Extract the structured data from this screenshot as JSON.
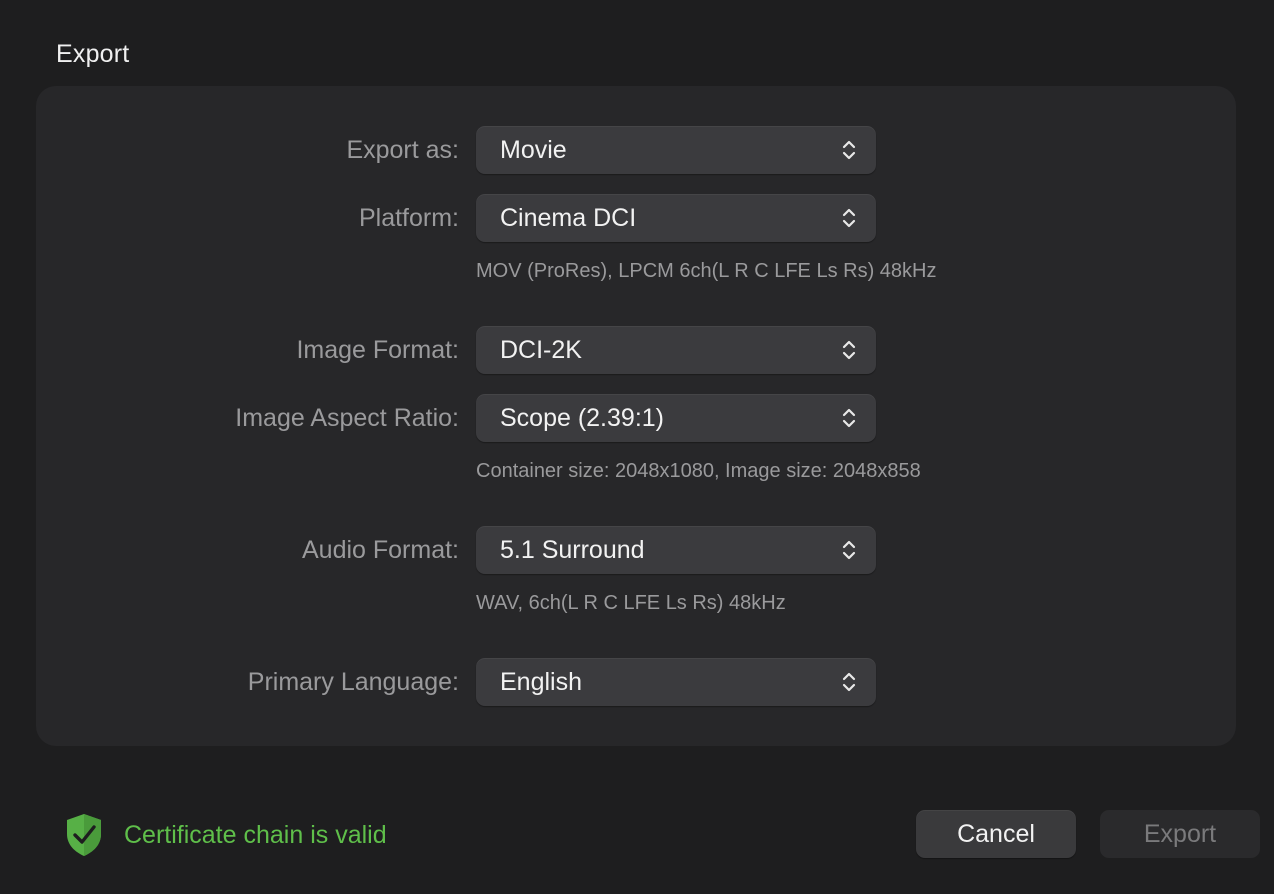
{
  "dialog": {
    "title": "Export"
  },
  "fields": {
    "export_as": {
      "label": "Export as:",
      "value": "Movie"
    },
    "platform": {
      "label": "Platform:",
      "value": "Cinema DCI",
      "hint": "MOV (ProRes), LPCM 6ch(L R C LFE Ls Rs) 48kHz"
    },
    "image_format": {
      "label": "Image Format:",
      "value": "DCI-2K"
    },
    "image_aspect_ratio": {
      "label": "Image Aspect Ratio:",
      "value": "Scope (2.39:1)",
      "hint": "Container size: 2048x1080, Image size: 2048x858"
    },
    "audio_format": {
      "label": "Audio Format:",
      "value": "5.1 Surround",
      "hint": "WAV, 6ch(L R C LFE Ls Rs) 48kHz"
    },
    "primary_language": {
      "label": "Primary Language:",
      "value": "English"
    }
  },
  "certificate": {
    "status": "Certificate chain is valid",
    "icon": "shield-check-icon",
    "color": "#5fbf4a"
  },
  "buttons": {
    "cancel": "Cancel",
    "export": "Export"
  }
}
